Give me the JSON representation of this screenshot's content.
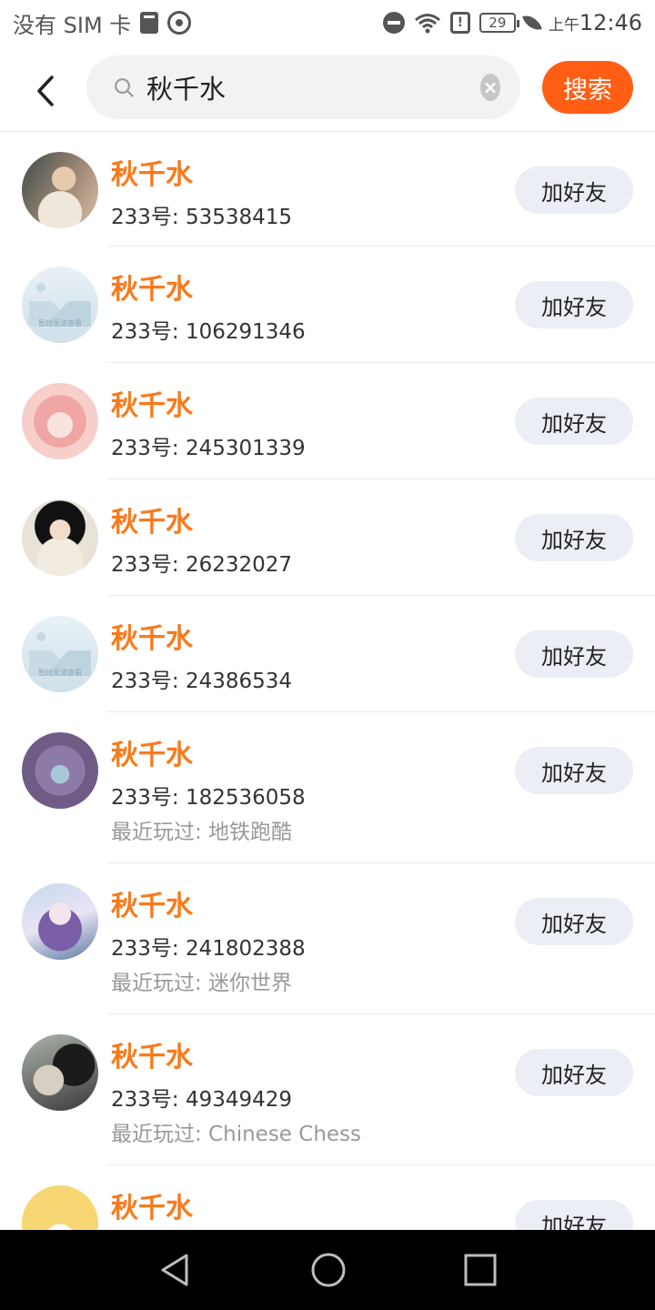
{
  "status_bar": {
    "carrier": "没有 SIM 卡",
    "battery": "29",
    "time_prefix": "上午",
    "time": "12:46"
  },
  "search": {
    "query": "秋千水",
    "button_label": "搜索"
  },
  "results": [
    {
      "name": "秋千水",
      "uid": "233号: 53538415",
      "played": "",
      "add_label": "加好友"
    },
    {
      "name": "秋千水",
      "uid": "233号: 106291346",
      "played": "",
      "add_label": "加好友",
      "placeholder_text": "暂时无法查看"
    },
    {
      "name": "秋千水",
      "uid": "233号: 245301339",
      "played": "",
      "add_label": "加好友"
    },
    {
      "name": "秋千水",
      "uid": "233号: 26232027",
      "played": "",
      "add_label": "加好友"
    },
    {
      "name": "秋千水",
      "uid": "233号: 24386534",
      "played": "",
      "add_label": "加好友",
      "placeholder_text": "暂时无法查看"
    },
    {
      "name": "秋千水",
      "uid": "233号: 182536058",
      "played": "最近玩过: 地铁跑酷",
      "add_label": "加好友"
    },
    {
      "name": "秋千水",
      "uid": "233号: 241802388",
      "played": "最近玩过: 迷你世界",
      "add_label": "加好友"
    },
    {
      "name": "秋千水",
      "uid": "233号: 49349429",
      "played": "最近玩过: Chinese Chess",
      "add_label": "加好友"
    },
    {
      "name": "秋千水",
      "uid": "",
      "played": "",
      "add_label": "加好友"
    }
  ],
  "colors": {
    "accent": "#ff5e14",
    "name_orange": "#f97a1c",
    "button_bg": "#eceef5"
  }
}
